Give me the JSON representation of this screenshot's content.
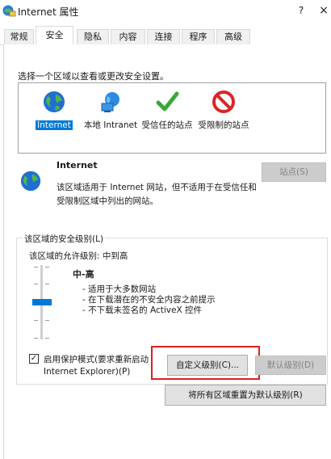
{
  "window": {
    "title": "Internet 属性",
    "help_label": "?",
    "close_label": "×"
  },
  "tabs": [
    {
      "label": "常规",
      "active": false
    },
    {
      "label": "安全",
      "active": true
    },
    {
      "label": "隐私",
      "active": false
    },
    {
      "label": "内容",
      "active": false
    },
    {
      "label": "连接",
      "active": false
    },
    {
      "label": "程序",
      "active": false
    },
    {
      "label": "高级",
      "active": false
    }
  ],
  "zones": {
    "prompt": "选择一个区域以查看或更改安全设置。",
    "items": [
      {
        "label": "Internet",
        "icon": "globe-icon",
        "selected": true
      },
      {
        "label": "本地 Intranet",
        "icon": "intranet-icon",
        "selected": false
      },
      {
        "label": "受信任的站点",
        "icon": "check-icon",
        "selected": false
      },
      {
        "label": "受限制的站点",
        "icon": "restricted-icon",
        "selected": false
      }
    ]
  },
  "zone_detail": {
    "title": "Internet",
    "description": "该区域适用于 Internet 网站，但不适用于在受信任和受限制区域中列出的网站。",
    "sites_button": "站点(S)"
  },
  "security_level": {
    "group_title": "该区域的安全级别(L)",
    "allowed_label": "该区域的允许级别: 中到高",
    "level_name": "中-高",
    "bullets": [
      "- 适用于大多数网站",
      "- 在下载潜在的不安全内容之前提示",
      "- 不下载未签名的 ActiveX 控件"
    ]
  },
  "protected_mode": {
    "checked": true,
    "label_line1": "启用保护模式(要求重新启动",
    "label_line2": "Internet Explorer)(P)"
  },
  "buttons": {
    "custom_level": "自定义级别(C)...",
    "default_level": "默认级别(D)",
    "reset_all": "将所有区域重置为默认级别(R)"
  },
  "colors": {
    "accent": "#0078d7",
    "highlight_box": "#e02020"
  }
}
